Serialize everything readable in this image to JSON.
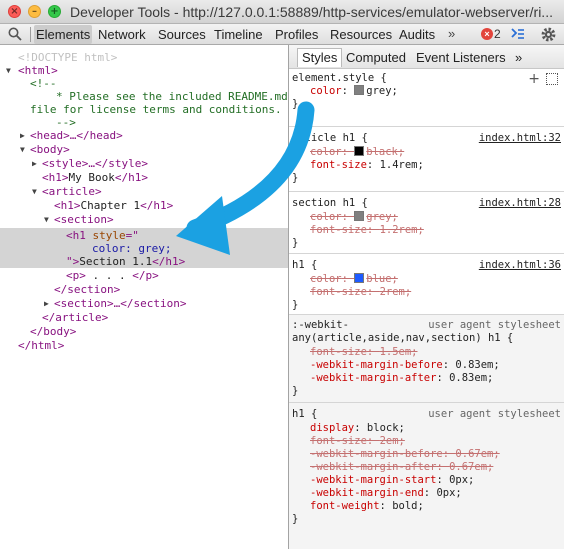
{
  "window": {
    "title": "Developer Tools - http://127.0.0.1:58889/http-services/emulator-webserver/ri...",
    "close_glyph": "×",
    "min_glyph": "–",
    "max_glyph": "+"
  },
  "toolbar": {
    "tabs": [
      "Elements",
      "Network",
      "Sources",
      "Timeline",
      "Profiles",
      "Resources",
      "Audits"
    ],
    "more": "»",
    "error_count": "2",
    "error_glyph": "×"
  },
  "dom": {
    "doctype": "<!DOCTYPE html>",
    "html_open": "<html>",
    "comment_open": "<!--",
    "comment_line1": "* Please see the included README.md",
    "comment_line2": "file for license terms and conditions.",
    "comment_close": "-->",
    "head": "<head>…</head>",
    "body_open": "<body>",
    "style": "<style>…</style>",
    "h1_open": "<h1>",
    "h1_text": "My Book",
    "h1_close": "</h1>",
    "article_open": "<article>",
    "h1b_text": "Chapter 1",
    "section_open": "<section>",
    "h1_style_open": "<h1 ",
    "h1_style_attr": "style",
    "h1_style_eq": "=\"",
    "h1_style_value": "color: grey;",
    "h1_style_tail": "\">",
    "h1_section_text": "Section 1.1",
    "p_open": "<p>",
    "p_text": " . . . ",
    "p_close": "</p>",
    "section_close": "</section>",
    "section_collapsed": "<section>…</section>",
    "article_close": "</article>",
    "body_close": "</body>",
    "html_close": "</html>"
  },
  "styles": {
    "subtabs": [
      "Styles",
      "Computed",
      "Event Listeners"
    ],
    "more": "»",
    "new_rule_glyph": "+",
    "element_style": {
      "selector": "element.style {",
      "prop": "color",
      "value": "grey;",
      "swatch": "#808080",
      "close": "}"
    },
    "rules": [
      {
        "selector": "article h1 {",
        "source": "index.html:32",
        "p1": "color",
        "v1": "black;",
        "sw1": "#000000",
        "p2": "font-size",
        "v2": "1.4rem;",
        "close": "}"
      },
      {
        "selector": "section h1 {",
        "source": "index.html:28",
        "p1": "color",
        "v1": "grey;",
        "sw1": "#808080",
        "p2": "font-size",
        "v2": "1.2rem;",
        "close": "}"
      },
      {
        "selector": "h1 {",
        "source": "index.html:36",
        "p1": "color",
        "v1": "blue;",
        "sw1": "#1e5bff",
        "p2": "font-size",
        "v2": "2rem;",
        "close": "}"
      }
    ],
    "ua1": {
      "selector1": ":-webkit-",
      "selector2": "any(article,aside,nav,section) h1 {",
      "source": "user agent stylesheet",
      "p1": "font-size",
      "v1": "1.5em;",
      "p2": "-webkit-margin-before",
      "v2": "0.83em;",
      "p3": "-webkit-margin-after",
      "v3": "0.83em;",
      "close": "}"
    },
    "ua2": {
      "selector": "h1 {",
      "source": "user agent stylesheet",
      "p1": "display",
      "v1": "block;",
      "p2": "font-size",
      "v2": "2em;",
      "p3": "-webkit-margin-before",
      "v3": "0.67em;",
      "p4": "-webkit-margin-after",
      "v4": "0.67em;",
      "p5": "-webkit-margin-start",
      "v5": "0px;",
      "p6": "-webkit-margin-end",
      "v6": "0px;",
      "p7": "font-weight",
      "v7": "bold;",
      "close": "}"
    }
  },
  "colors": {
    "arrow": "#1ba1e2",
    "tag": "#881280",
    "attribute": "#994500",
    "property": "#c80000"
  }
}
